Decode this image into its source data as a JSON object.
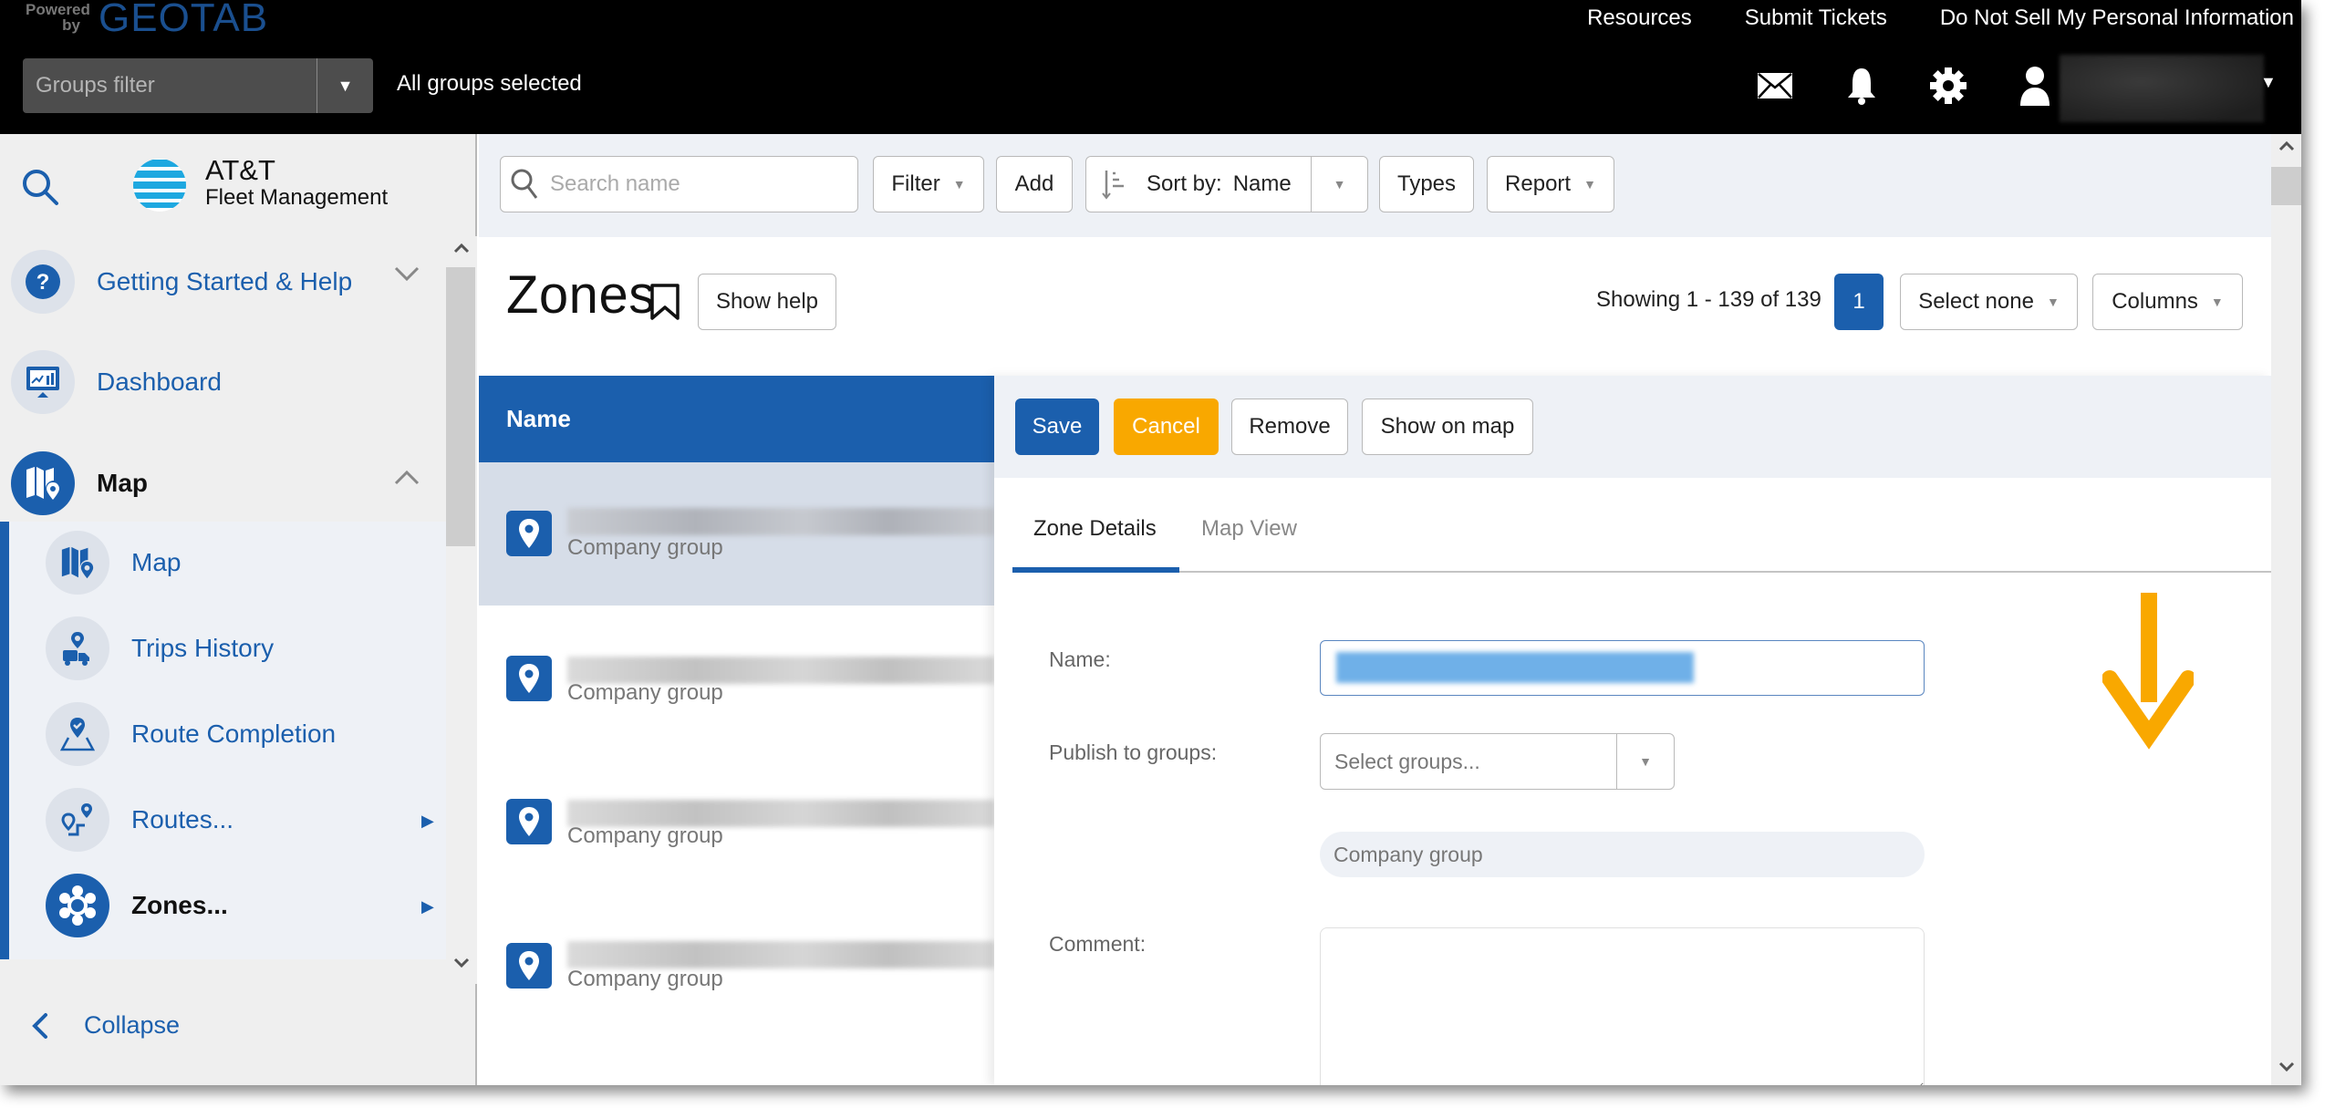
{
  "header": {
    "powered_by": "Powered by",
    "brand": "GEOTAB",
    "groups_filter_placeholder": "Groups filter",
    "groups_status": "All groups selected",
    "links": [
      "Resources",
      "Submit Tickets",
      "Do Not Sell My Personal Information"
    ],
    "icons": [
      "mail-icon",
      "bell-icon",
      "gear-icon",
      "user-icon"
    ]
  },
  "sidebar": {
    "logo_line1": "AT&T",
    "logo_line2": "Fleet Management",
    "items": [
      {
        "label": "Getting Started & Help",
        "icon": "help-icon",
        "expand": "chevron-down"
      },
      {
        "label": "Dashboard",
        "icon": "dashboard-icon"
      },
      {
        "label": "Map",
        "icon": "map-icon",
        "expand": "chevron-up",
        "active": true
      }
    ],
    "sub_items": [
      {
        "label": "Map",
        "icon": "map-icon"
      },
      {
        "label": "Trips History",
        "icon": "trips-history-icon"
      },
      {
        "label": "Route Completion",
        "icon": "route-completion-icon"
      },
      {
        "label": "Routes...",
        "icon": "routes-icon",
        "has_submenu": true
      },
      {
        "label": "Zones...",
        "icon": "zones-icon",
        "has_submenu": true,
        "active": true
      }
    ],
    "collapse_label": "Collapse"
  },
  "toolbar": {
    "search_placeholder": "Search name",
    "search_value": "",
    "filter_label": "Filter",
    "add_label": "Add",
    "sort_prefix": "Sort by:",
    "sort_value": "Name",
    "types_label": "Types",
    "report_label": "Report"
  },
  "page": {
    "title": "Zones",
    "show_help": "Show help",
    "showing": "Showing 1 - 139 of 139",
    "current_page": "1",
    "select_none": "Select none",
    "columns": "Columns"
  },
  "list": {
    "column_header": "Name",
    "rows": [
      {
        "name": "[redacted]",
        "group": "Company group",
        "selected": true
      },
      {
        "name": "[redacted]",
        "group": "Company group",
        "selected": false
      },
      {
        "name": "[redacted]",
        "group": "Company group",
        "selected": false
      },
      {
        "name": "[redacted]",
        "group": "Company group",
        "selected": false
      }
    ]
  },
  "detail": {
    "save": "Save",
    "cancel": "Cancel",
    "remove": "Remove",
    "show_on_map": "Show on map",
    "tabs": [
      {
        "label": "Zone Details",
        "active": true
      },
      {
        "label": "Map View",
        "active": false
      }
    ],
    "name_label": "Name:",
    "name_value": "[redacted]",
    "publish_label": "Publish to groups:",
    "publish_placeholder": "Select groups...",
    "selected_group": "Company group",
    "comment_label": "Comment:",
    "comment_value": ""
  },
  "annotation": {
    "type": "down-arrow",
    "color": "#f9a800"
  },
  "colors": {
    "brand_blue": "#1b5fad",
    "cancel_orange": "#f9a800",
    "header_black": "#000000"
  }
}
